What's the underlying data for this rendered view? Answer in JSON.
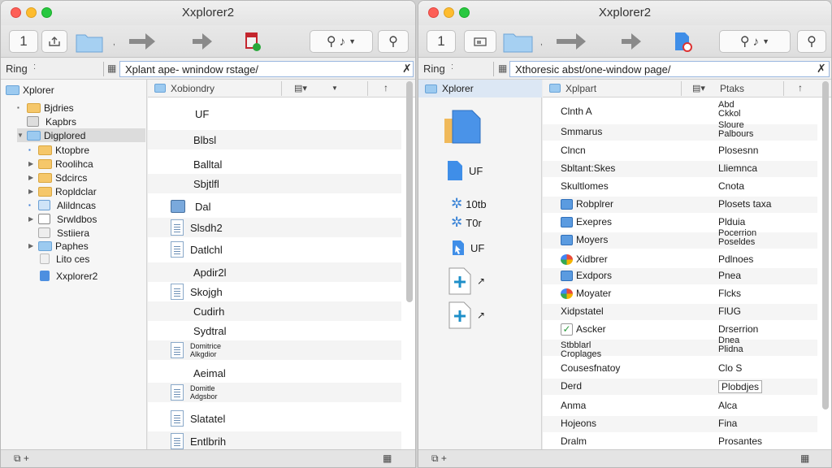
{
  "windows": {
    "left": {
      "title": "Xxplorer2",
      "toolbar": {
        "page_num": "1"
      },
      "address": {
        "ring_label": "Ring",
        "path": "Xplant ape- wnindow rstage/"
      },
      "tree": [
        {
          "label": "Xplorer",
          "kind": "blue",
          "expander": ""
        },
        {
          "label": "Bjdries",
          "kind": "yellow",
          "expander": "▪"
        },
        {
          "label": "Kapbrs",
          "kind": "icon",
          "expander": ""
        },
        {
          "label": "Digplored",
          "kind": "blue",
          "expander": "▼",
          "selected": true
        },
        {
          "label": "Ktopbre",
          "kind": "yellow",
          "expander": "▪"
        },
        {
          "label": "Roolihca",
          "kind": "yellow",
          "expander": "▶"
        },
        {
          "label": "Sdcircs",
          "kind": "yellow",
          "expander": "▶"
        },
        {
          "label": "Ropldclar",
          "kind": "yellow",
          "expander": "▶"
        },
        {
          "label": "Alildncas",
          "kind": "icon",
          "expander": "▪"
        },
        {
          "label": "Srwldbos",
          "kind": "icon",
          "expander": "▶"
        },
        {
          "label": "Sstiiera",
          "kind": "icon",
          "expander": ""
        },
        {
          "label": "Paphes",
          "kind": "blue",
          "expander": "▶"
        },
        {
          "label": "Lito ces",
          "kind": "icon",
          "expander": ""
        },
        {
          "label": "Xxplorer2",
          "kind": "file",
          "expander": ""
        }
      ],
      "list_header": {
        "name": "Xobiondry"
      },
      "list": [
        {
          "label": "UF",
          "kind": "bigfolder"
        },
        {
          "label": "Blbsl",
          "kind": "folder"
        },
        {
          "label": "Balltal",
          "kind": "folder"
        },
        {
          "label": "Sbjtlfl",
          "kind": "folder"
        },
        {
          "label": "Dal",
          "kind": "app"
        },
        {
          "label": "Slsdh2",
          "kind": "doc"
        },
        {
          "label": "Datlchl",
          "kind": "doc"
        },
        {
          "label": "Apdir2l",
          "kind": "folder"
        },
        {
          "label": "Skojgh",
          "kind": "doc"
        },
        {
          "label": "Cudirh",
          "kind": "folder"
        },
        {
          "label": "Sydtral",
          "kind": "folder"
        },
        {
          "label": "Domitrice\nAlkgdior",
          "kind": "doc"
        },
        {
          "label": "Aeimal",
          "kind": "folder"
        },
        {
          "label": "Domitle\nAdgsbor",
          "kind": "doc"
        },
        {
          "label": "Slatatel",
          "kind": "doc"
        },
        {
          "label": "Entlbrih",
          "kind": "doc"
        }
      ],
      "status_left": "⧉ +",
      "status_right": "▦"
    },
    "right": {
      "title": "Xxplorer2",
      "toolbar": {
        "page_num": "1"
      },
      "address": {
        "ring_label": "Ring",
        "path": "Xthoresic abst/one-window page/"
      },
      "side_title": "Xplorer",
      "side_items": [
        {
          "label": "",
          "kind": "bigdoc"
        },
        {
          "label": "UF",
          "kind": "doc"
        },
        {
          "label": "10tb",
          "kind": "gear"
        },
        {
          "label": "T0r",
          "kind": "gear"
        },
        {
          "label": "UF",
          "kind": "cursor"
        },
        {
          "label": "↗",
          "kind": "plus"
        },
        {
          "label": "↗",
          "kind": "plus"
        }
      ],
      "list_header": {
        "name": "Xplpart",
        "col2": "Ptaks"
      },
      "rows": [
        {
          "name": "Clnth A",
          "col2": "Abd\nCkkol",
          "icon": ""
        },
        {
          "name": "Smmarus",
          "col2": "Sloure\nPalbours",
          "icon": ""
        },
        {
          "name": "Clncn",
          "col2": "Plosesnn",
          "icon": ""
        },
        {
          "name": "Sbltant:Skes",
          "col2": "Lliemnca",
          "icon": ""
        },
        {
          "name": "Skultlomes",
          "col2": "Cnota",
          "icon": ""
        },
        {
          "name": "Robplrer",
          "col2": "Plosets taxa",
          "icon": "blue"
        },
        {
          "name": "Exepres",
          "col2": "Plduia",
          "icon": "blue"
        },
        {
          "name": "Moyers",
          "col2": "Pocerrion\nPoseldes",
          "icon": "blue"
        },
        {
          "name": "Xidbrer",
          "col2": "Pdlnoes",
          "icon": "multi"
        },
        {
          "name": "Exdpors",
          "col2": "Pnea",
          "icon": "blue"
        },
        {
          "name": "Moyater",
          "col2": "Flcks",
          "icon": "multi"
        },
        {
          "name": "Xidpstatel",
          "col2": "FlUG",
          "icon": ""
        },
        {
          "name": "Ascker",
          "col2": "Drserrion",
          "icon": "check"
        },
        {
          "name": "Stbblarl\nCroplages",
          "col2": "Dnea\nPlidna",
          "icon": ""
        },
        {
          "name": "Cousesfnatoy",
          "col2": "Clo S",
          "icon": ""
        },
        {
          "name": "Derd",
          "col2": "Plobdjes",
          "icon": ""
        },
        {
          "name": "Anma",
          "col2": "Alca",
          "icon": ""
        },
        {
          "name": "Hojeons",
          "col2": "Fina",
          "icon": ""
        },
        {
          "name": "Dralm",
          "col2": "Prosantes",
          "icon": ""
        }
      ],
      "status_left": "⧉ +",
      "status_right": "▦"
    }
  }
}
